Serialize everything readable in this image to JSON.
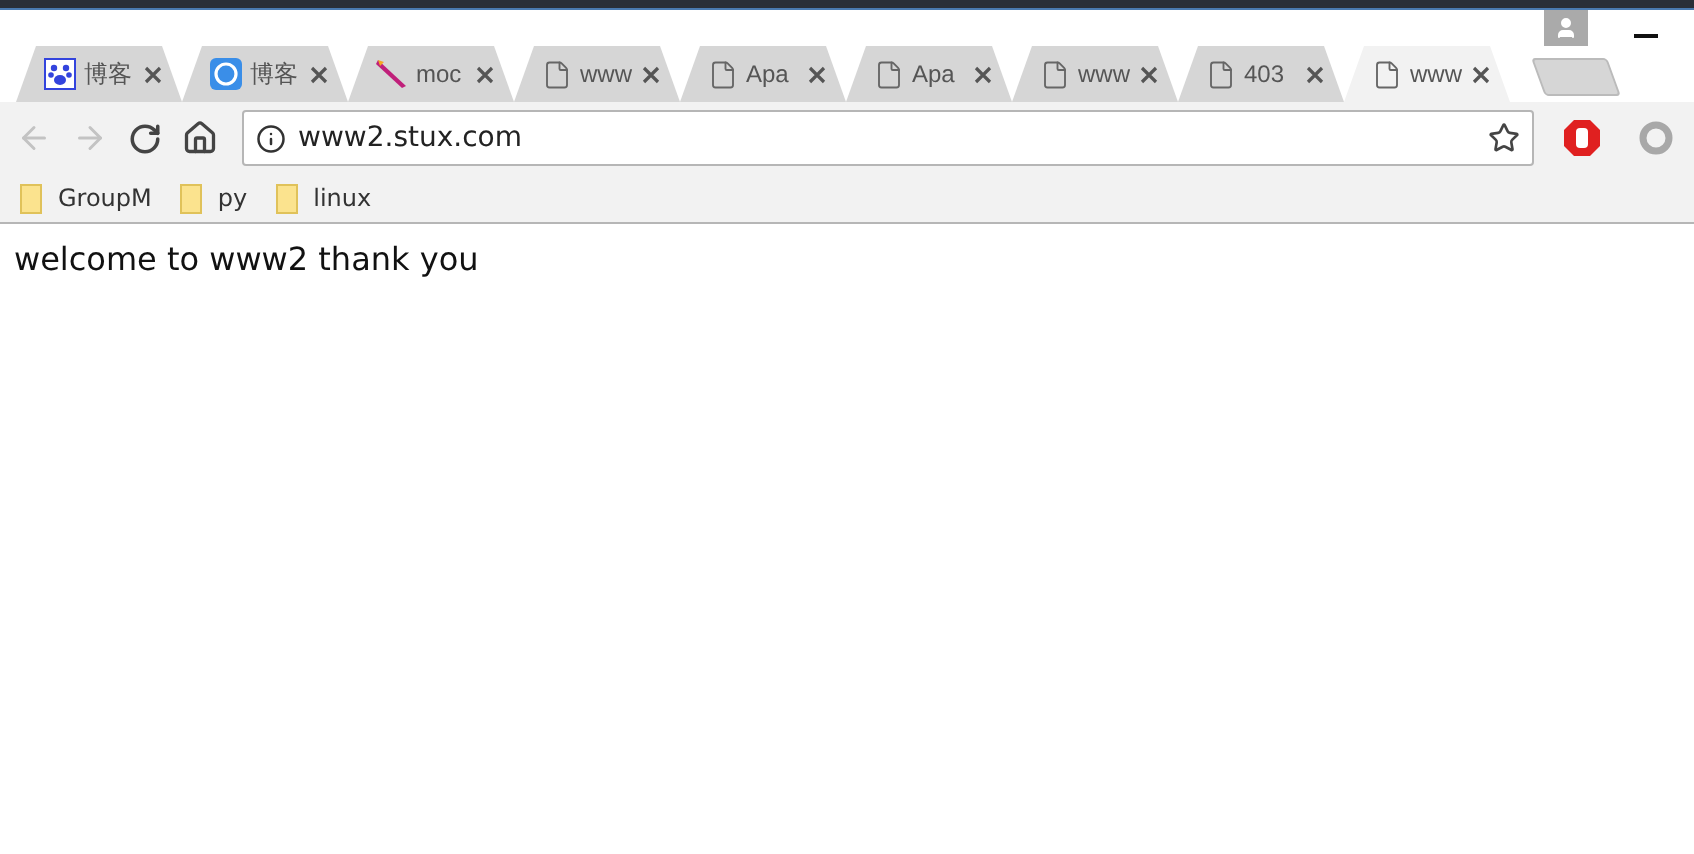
{
  "tabs": [
    {
      "title": "博客",
      "kind": "paw",
      "selected": false
    },
    {
      "title": "博客",
      "kind": "badge",
      "selected": false
    },
    {
      "title": "moc",
      "kind": "feather",
      "selected": false
    },
    {
      "title": "www",
      "kind": "page",
      "selected": false
    },
    {
      "title": "Apa",
      "kind": "page",
      "selected": false
    },
    {
      "title": "Apa",
      "kind": "page",
      "selected": false
    },
    {
      "title": "www",
      "kind": "page",
      "selected": false
    },
    {
      "title": "403",
      "kind": "page",
      "selected": false
    },
    {
      "title": "www",
      "kind": "page",
      "selected": true
    }
  ],
  "address_bar": {
    "value": "www2.stux.com"
  },
  "bookmarks": [
    {
      "label": "GroupM"
    },
    {
      "label": "py"
    },
    {
      "label": "linux"
    }
  ],
  "page": {
    "text": "welcome to www2 thank you"
  }
}
